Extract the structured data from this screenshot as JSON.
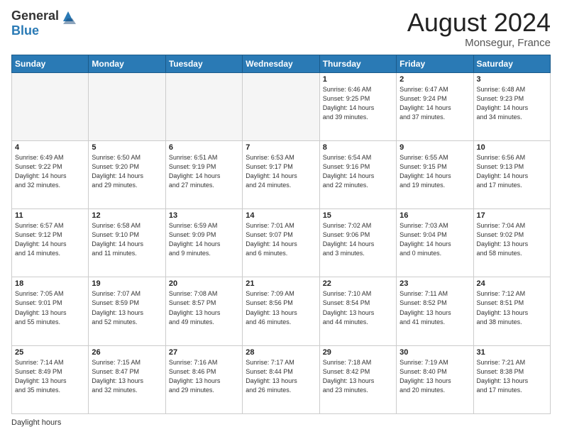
{
  "logo": {
    "text_general": "General",
    "text_blue": "Blue"
  },
  "title": "August 2024",
  "subtitle": "Monsegur, France",
  "days_header": [
    "Sunday",
    "Monday",
    "Tuesday",
    "Wednesday",
    "Thursday",
    "Friday",
    "Saturday"
  ],
  "footer_text": "Daylight hours",
  "weeks": [
    [
      {
        "day": "",
        "info": ""
      },
      {
        "day": "",
        "info": ""
      },
      {
        "day": "",
        "info": ""
      },
      {
        "day": "",
        "info": ""
      },
      {
        "day": "1",
        "info": "Sunrise: 6:46 AM\nSunset: 9:25 PM\nDaylight: 14 hours\nand 39 minutes."
      },
      {
        "day": "2",
        "info": "Sunrise: 6:47 AM\nSunset: 9:24 PM\nDaylight: 14 hours\nand 37 minutes."
      },
      {
        "day": "3",
        "info": "Sunrise: 6:48 AM\nSunset: 9:23 PM\nDaylight: 14 hours\nand 34 minutes."
      }
    ],
    [
      {
        "day": "4",
        "info": "Sunrise: 6:49 AM\nSunset: 9:22 PM\nDaylight: 14 hours\nand 32 minutes."
      },
      {
        "day": "5",
        "info": "Sunrise: 6:50 AM\nSunset: 9:20 PM\nDaylight: 14 hours\nand 29 minutes."
      },
      {
        "day": "6",
        "info": "Sunrise: 6:51 AM\nSunset: 9:19 PM\nDaylight: 14 hours\nand 27 minutes."
      },
      {
        "day": "7",
        "info": "Sunrise: 6:53 AM\nSunset: 9:17 PM\nDaylight: 14 hours\nand 24 minutes."
      },
      {
        "day": "8",
        "info": "Sunrise: 6:54 AM\nSunset: 9:16 PM\nDaylight: 14 hours\nand 22 minutes."
      },
      {
        "day": "9",
        "info": "Sunrise: 6:55 AM\nSunset: 9:15 PM\nDaylight: 14 hours\nand 19 minutes."
      },
      {
        "day": "10",
        "info": "Sunrise: 6:56 AM\nSunset: 9:13 PM\nDaylight: 14 hours\nand 17 minutes."
      }
    ],
    [
      {
        "day": "11",
        "info": "Sunrise: 6:57 AM\nSunset: 9:12 PM\nDaylight: 14 hours\nand 14 minutes."
      },
      {
        "day": "12",
        "info": "Sunrise: 6:58 AM\nSunset: 9:10 PM\nDaylight: 14 hours\nand 11 minutes."
      },
      {
        "day": "13",
        "info": "Sunrise: 6:59 AM\nSunset: 9:09 PM\nDaylight: 14 hours\nand 9 minutes."
      },
      {
        "day": "14",
        "info": "Sunrise: 7:01 AM\nSunset: 9:07 PM\nDaylight: 14 hours\nand 6 minutes."
      },
      {
        "day": "15",
        "info": "Sunrise: 7:02 AM\nSunset: 9:06 PM\nDaylight: 14 hours\nand 3 minutes."
      },
      {
        "day": "16",
        "info": "Sunrise: 7:03 AM\nSunset: 9:04 PM\nDaylight: 14 hours\nand 0 minutes."
      },
      {
        "day": "17",
        "info": "Sunrise: 7:04 AM\nSunset: 9:02 PM\nDaylight: 13 hours\nand 58 minutes."
      }
    ],
    [
      {
        "day": "18",
        "info": "Sunrise: 7:05 AM\nSunset: 9:01 PM\nDaylight: 13 hours\nand 55 minutes."
      },
      {
        "day": "19",
        "info": "Sunrise: 7:07 AM\nSunset: 8:59 PM\nDaylight: 13 hours\nand 52 minutes."
      },
      {
        "day": "20",
        "info": "Sunrise: 7:08 AM\nSunset: 8:57 PM\nDaylight: 13 hours\nand 49 minutes."
      },
      {
        "day": "21",
        "info": "Sunrise: 7:09 AM\nSunset: 8:56 PM\nDaylight: 13 hours\nand 46 minutes."
      },
      {
        "day": "22",
        "info": "Sunrise: 7:10 AM\nSunset: 8:54 PM\nDaylight: 13 hours\nand 44 minutes."
      },
      {
        "day": "23",
        "info": "Sunrise: 7:11 AM\nSunset: 8:52 PM\nDaylight: 13 hours\nand 41 minutes."
      },
      {
        "day": "24",
        "info": "Sunrise: 7:12 AM\nSunset: 8:51 PM\nDaylight: 13 hours\nand 38 minutes."
      }
    ],
    [
      {
        "day": "25",
        "info": "Sunrise: 7:14 AM\nSunset: 8:49 PM\nDaylight: 13 hours\nand 35 minutes."
      },
      {
        "day": "26",
        "info": "Sunrise: 7:15 AM\nSunset: 8:47 PM\nDaylight: 13 hours\nand 32 minutes."
      },
      {
        "day": "27",
        "info": "Sunrise: 7:16 AM\nSunset: 8:46 PM\nDaylight: 13 hours\nand 29 minutes."
      },
      {
        "day": "28",
        "info": "Sunrise: 7:17 AM\nSunset: 8:44 PM\nDaylight: 13 hours\nand 26 minutes."
      },
      {
        "day": "29",
        "info": "Sunrise: 7:18 AM\nSunset: 8:42 PM\nDaylight: 13 hours\nand 23 minutes."
      },
      {
        "day": "30",
        "info": "Sunrise: 7:19 AM\nSunset: 8:40 PM\nDaylight: 13 hours\nand 20 minutes."
      },
      {
        "day": "31",
        "info": "Sunrise: 7:21 AM\nSunset: 8:38 PM\nDaylight: 13 hours\nand 17 minutes."
      }
    ]
  ]
}
